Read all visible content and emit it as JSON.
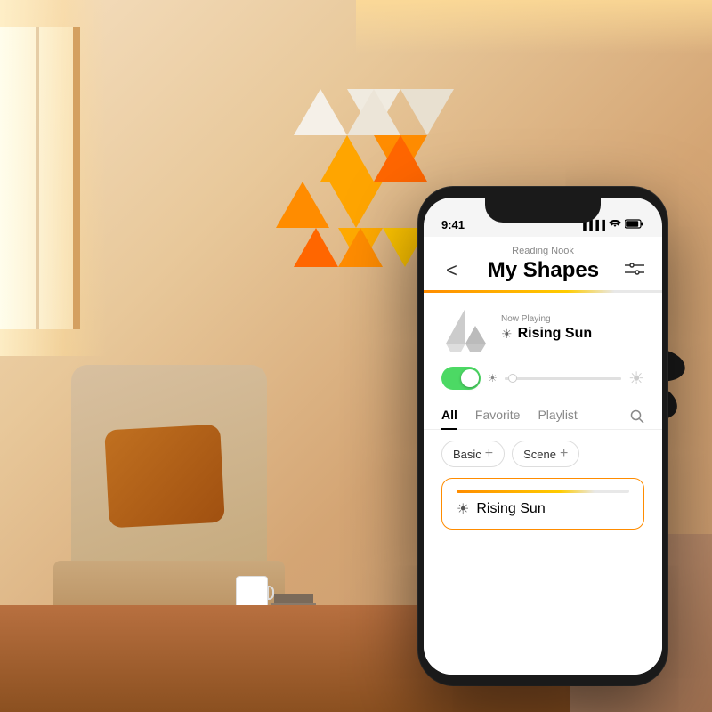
{
  "room": {
    "description": "Cozy reading nook with Nanoleaf panels"
  },
  "phone": {
    "status_bar": {
      "time": "9:41",
      "signal_bars": "●●●●",
      "wifi_icon": "wifi",
      "battery_icon": "battery"
    },
    "header": {
      "subtitle": "Reading Nook",
      "title": "My Shapes",
      "back_label": "<",
      "filter_label": "⫶"
    },
    "now_playing": {
      "label": "Now Playing",
      "name": "Rising Sun"
    },
    "tabs": [
      {
        "id": "all",
        "label": "All",
        "active": true
      },
      {
        "id": "favorite",
        "label": "Favorite",
        "active": false
      },
      {
        "id": "playlist",
        "label": "Playlist",
        "active": false
      }
    ],
    "categories": [
      {
        "id": "basic",
        "label": "Basic"
      },
      {
        "id": "scene",
        "label": "Scene"
      }
    ],
    "scene_item": {
      "name": "Rising Sun"
    }
  }
}
